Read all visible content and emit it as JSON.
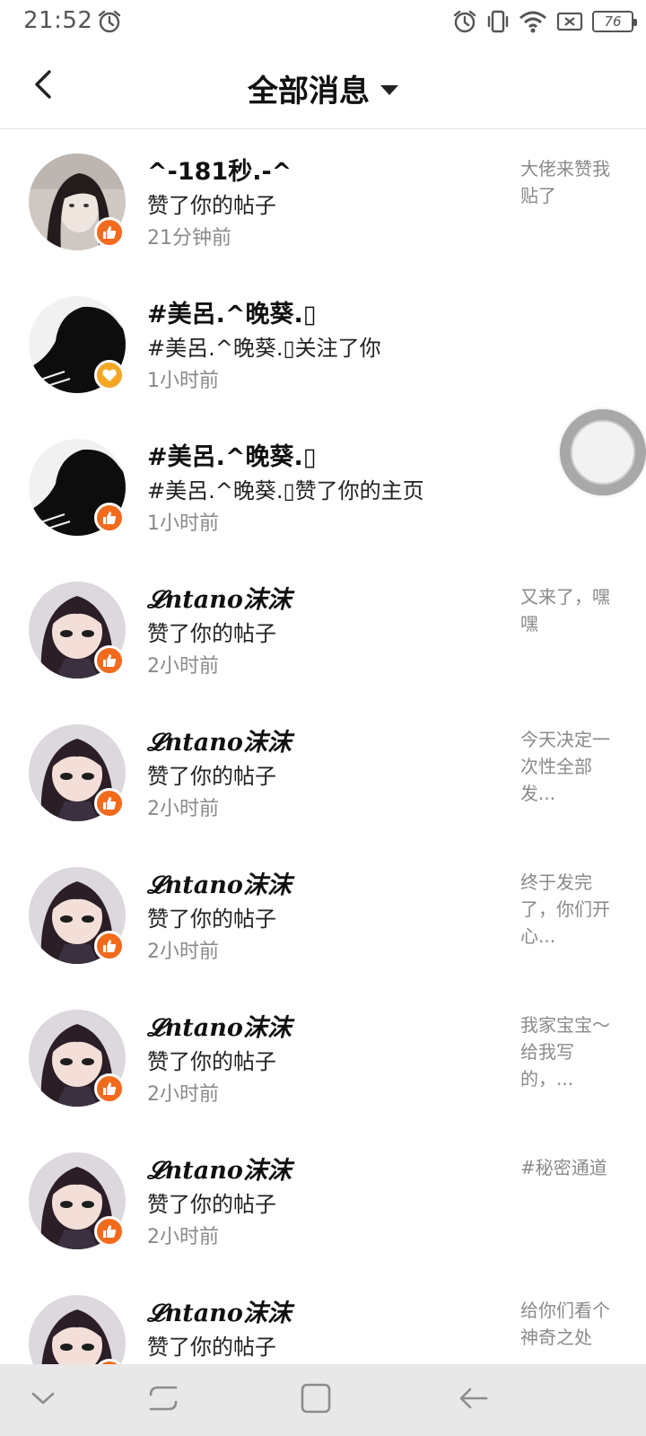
{
  "status_bar": {
    "time": "21:52",
    "battery": "76",
    "icons": [
      "alarm-icon",
      "vibrate-icon",
      "wifi-icon",
      "no-sim-icon",
      "battery-icon"
    ]
  },
  "header": {
    "title": "全部消息",
    "back_icon": "back-arrow-icon",
    "dropdown_icon": "caret-down-icon"
  },
  "messages": [
    {
      "name": "^-181秒.-^",
      "action": "赞了你的帖子",
      "time": "21分钟前",
      "snippet": "大佬来赞我贴了",
      "badge": "like",
      "avatar": "girl-photo"
    },
    {
      "name": "#美呂.^晚葵.▯",
      "action": "#美呂.^晚葵.▯关注了你",
      "time": "1小时前",
      "snippet": "",
      "badge": "follow",
      "avatar": "silhouette"
    },
    {
      "name": "#美呂.^晚葵.▯",
      "action": "#美呂.^晚葵.▯赞了你的主页",
      "time": "1小时前",
      "snippet": "",
      "badge": "like",
      "avatar": "silhouette"
    },
    {
      "name": "𝓛ntano沫沫",
      "action": "赞了你的帖子",
      "time": "2小时前",
      "snippet": "又来了，嘿嘿",
      "badge": "like",
      "avatar": "anime-girl"
    },
    {
      "name": "𝓛ntano沫沫",
      "action": "赞了你的帖子",
      "time": "2小时前",
      "snippet": "今天决定一次性全部发...",
      "badge": "like",
      "avatar": "anime-girl"
    },
    {
      "name": "𝓛ntano沫沫",
      "action": "赞了你的帖子",
      "time": "2小时前",
      "snippet": "终于发完了，你们开心...",
      "badge": "like",
      "avatar": "anime-girl"
    },
    {
      "name": "𝓛ntano沫沫",
      "action": "赞了你的帖子",
      "time": "2小时前",
      "snippet": "我家宝宝～给我写的，...",
      "badge": "like",
      "avatar": "anime-girl"
    },
    {
      "name": "𝓛ntano沫沫",
      "action": "赞了你的帖子",
      "time": "2小时前",
      "snippet": "#秘密通道",
      "badge": "like",
      "avatar": "anime-girl"
    },
    {
      "name": "𝓛ntano沫沫",
      "action": "赞了你的帖子",
      "time": "",
      "snippet": "给你们看个神奇之处",
      "badge": "like",
      "avatar": "anime-girl"
    }
  ],
  "colors": {
    "like_badge": "#f26b1d",
    "follow_badge": "#f5a623",
    "secondary_text": "#8a8a8a",
    "navbar_bg": "#e8e8e8"
  },
  "navbar": {
    "icons": [
      "hide-keyboard-icon",
      "recent-apps-icon",
      "home-icon",
      "back-icon"
    ]
  }
}
